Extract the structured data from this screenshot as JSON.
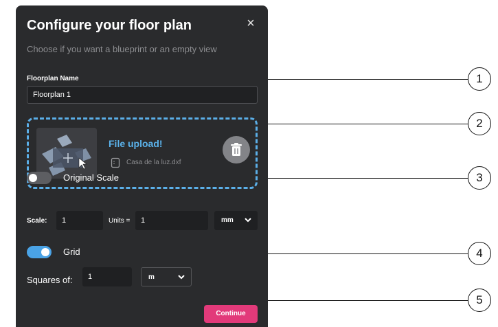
{
  "dialog": {
    "title": "Configure your floor plan",
    "subtitle": "Choose if you want a blueprint or an empty view",
    "close_symbol": "×"
  },
  "floorplan": {
    "label": "Floorplan Name",
    "value": "Floorplan 1"
  },
  "upload": {
    "title": "File upload!",
    "file_name": "Casa de la luz.dxf",
    "icons": {
      "file": "file-icon",
      "delete": "trash-icon",
      "thumbnail": "floorplan-thumbnail"
    },
    "border_color": "#5bafe8"
  },
  "scale": {
    "toggle_label": "Original Scale",
    "toggle_on": false,
    "scale_label": "Scale:",
    "scale_value": "1",
    "units_label": "Units =",
    "units_value": "1",
    "unit_select": "mm"
  },
  "grid": {
    "toggle_label": "Grid",
    "toggle_on": true,
    "squares_label": "Squares of:",
    "squares_value": "1",
    "unit_select": "m"
  },
  "actions": {
    "continue_label": "Continue",
    "continue_color": "#e23a7a"
  },
  "callouts": [
    "1",
    "2",
    "3",
    "4",
    "5"
  ],
  "colors": {
    "panel_bg": "#2a2b2d",
    "accent_blue": "#4aa3e6"
  }
}
